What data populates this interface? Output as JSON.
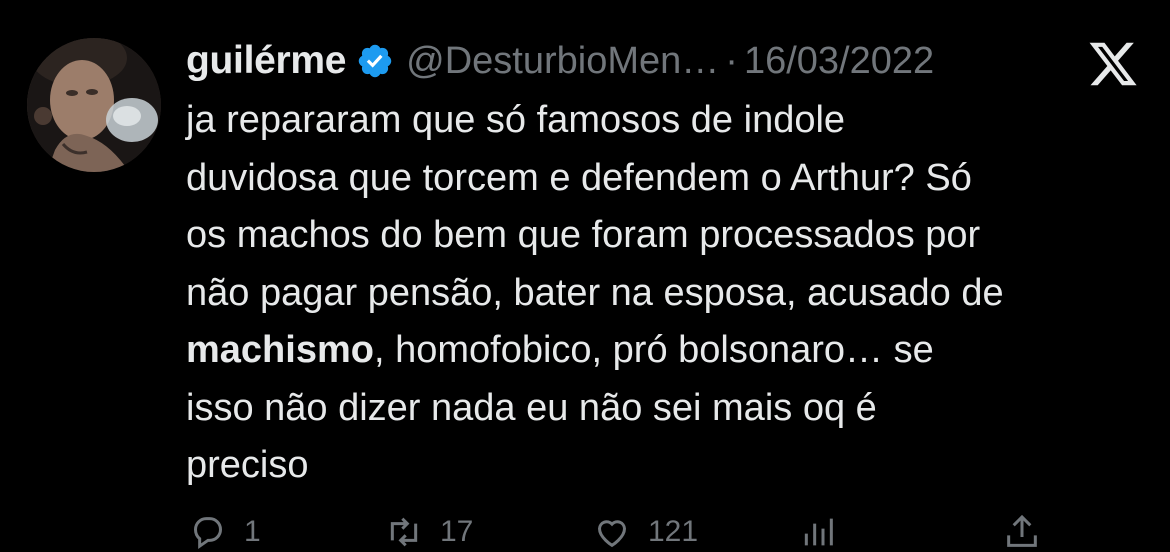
{
  "tweet": {
    "display_name": "guilérme",
    "verified": true,
    "handle": "@DesturbioMen…",
    "separator": "·",
    "date": "16/03/2022",
    "body_lines": [
      "ja repararam que só famosos de indole",
      "duvidosa que torcem e defendem o Arthur? Só",
      "os machos do bem  que foram processados por",
      "não pagar pensão, bater na esposa, acusado de"
    ],
    "line5_bold": "machismo",
    "line5_rest": ", homofobico, pró bolsonaro… se",
    "body_lines_end": [
      "isso não dizer nada eu não sei mais oq é",
      "preciso"
    ]
  },
  "actions": {
    "reply_count": "1",
    "retweet_count": "17",
    "like_count": "121"
  },
  "icons": {
    "verified": "verified-badge-icon",
    "platform_logo": "x-logo-icon",
    "reply": "reply-icon",
    "retweet": "retweet-icon",
    "like": "heart-icon",
    "views": "views-icon",
    "share": "share-icon"
  },
  "colors": {
    "background": "#000000",
    "text_primary": "#e7e9ea",
    "text_secondary": "#71767b",
    "verified_blue": "#1d9bf0"
  }
}
